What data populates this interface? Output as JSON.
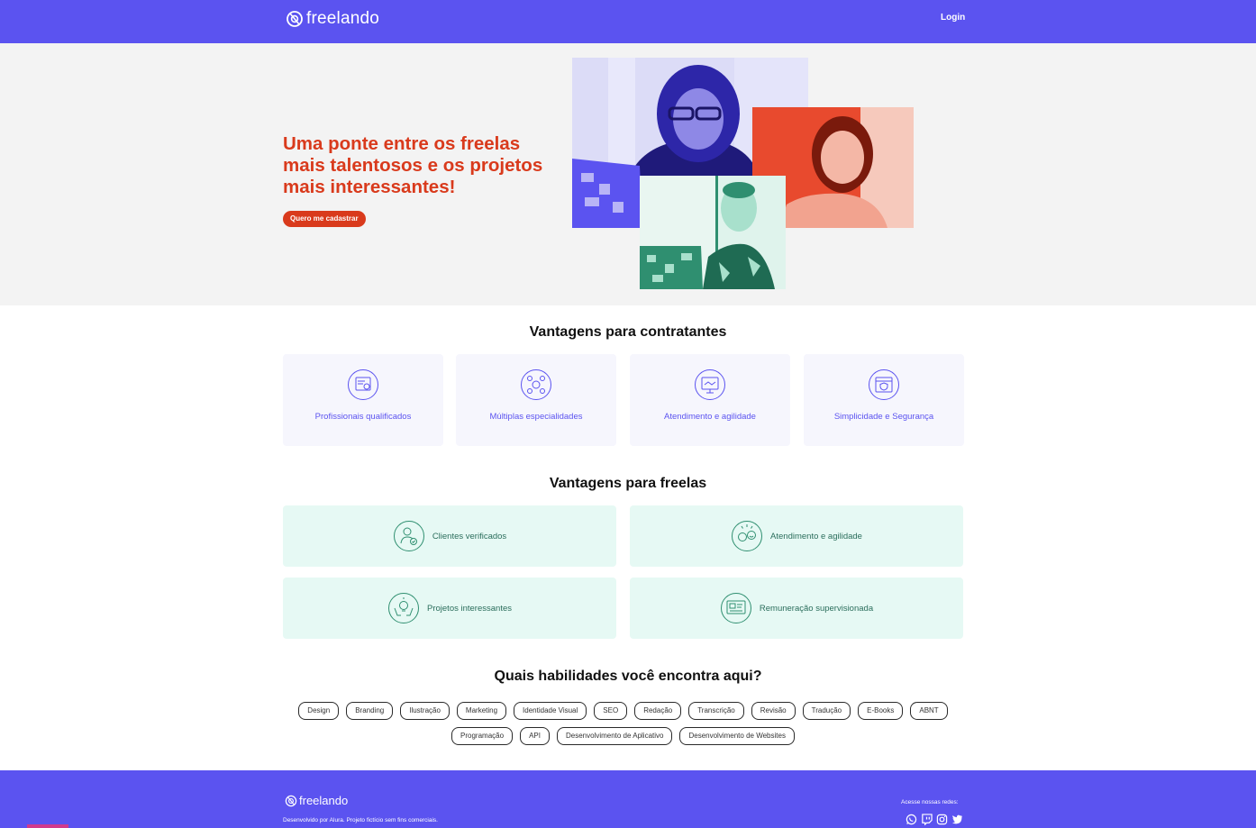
{
  "header": {
    "brand": "freelando",
    "login_label": "Login"
  },
  "hero": {
    "title": "Uma ponte entre os freelas mais talentosos e os projetos mais interessantes!",
    "cta_label": "Quero me cadastrar"
  },
  "contratantes": {
    "title": "Vantagens para contratantes",
    "cards": [
      {
        "label": "Profissionais qualificados",
        "icon": "certificate-icon"
      },
      {
        "label": "Múltiplas especialidades",
        "icon": "network-icon"
      },
      {
        "label": "Atendimento e agilidade",
        "icon": "handshake-icon"
      },
      {
        "label": "Simplicidade e Segurança",
        "icon": "secure-browser-icon"
      }
    ]
  },
  "freelas": {
    "title": "Vantagens para freelas",
    "cards": [
      {
        "label": "Clientes verificados",
        "icon": "verified-user-icon"
      },
      {
        "label": "Atendimento e agilidade",
        "icon": "happy-faces-icon"
      },
      {
        "label": "Projetos interessantes",
        "icon": "idea-hands-icon"
      },
      {
        "label": "Remuneração supervisionada",
        "icon": "payment-screen-icon"
      }
    ]
  },
  "skills": {
    "title": "Quais habilidades você encontra aqui?",
    "tags": [
      "Design",
      "Branding",
      "Ilustração",
      "Marketing",
      "Identidade Visual",
      "SEO",
      "Redação",
      "Transcrição",
      "Revisão",
      "Tradução",
      "E-Books",
      "ABNT",
      "Programação",
      "API",
      "Desenvolvimento de Aplicativo",
      "Desenvolvimento de Websites"
    ]
  },
  "footer": {
    "brand": "freelando",
    "note": "Desenvolvido por Alura. Projeto fictício sem fins comerciais.",
    "social_title": "Acesse nossas redes:",
    "social": [
      "whatsapp-icon",
      "twitch-icon",
      "instagram-icon",
      "twitter-icon"
    ]
  },
  "colors": {
    "brand": "#5b53f0",
    "accent": "#d93a1c",
    "freela_card": "#e6f9f4",
    "freela_text": "#2b6e5c"
  }
}
